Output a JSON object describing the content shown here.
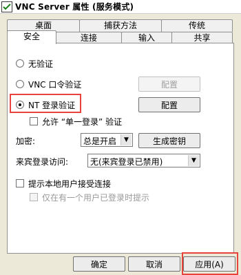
{
  "window": {
    "title": "VNC Server 属性 (服务模式)"
  },
  "tabs_back": [
    "桌面",
    "捕获方法",
    "传统"
  ],
  "tabs_front": [
    "安全",
    "连接",
    "输入",
    "共享"
  ],
  "auth": {
    "none_label": "无验证",
    "vnc_label": "VNC 口令验证",
    "nt_label": "NT 登录验证",
    "single_signon_label": "允许 “单一登录” 验证",
    "config_label": "配置",
    "selected": "nt"
  },
  "encryption": {
    "label": "加密:",
    "value": "总是开启",
    "generate_key_label": "生成密钥"
  },
  "guest": {
    "label": "来宾登录访问:",
    "value": "无(来宾登录已禁用)"
  },
  "prompt": {
    "accept_label": "提示本地用户接受连接",
    "only_logged_label": "仅在有一个用户已登录时提示"
  },
  "footer": {
    "ok_label": "确定",
    "cancel_label": "取消",
    "apply_label": "应用(A)"
  }
}
